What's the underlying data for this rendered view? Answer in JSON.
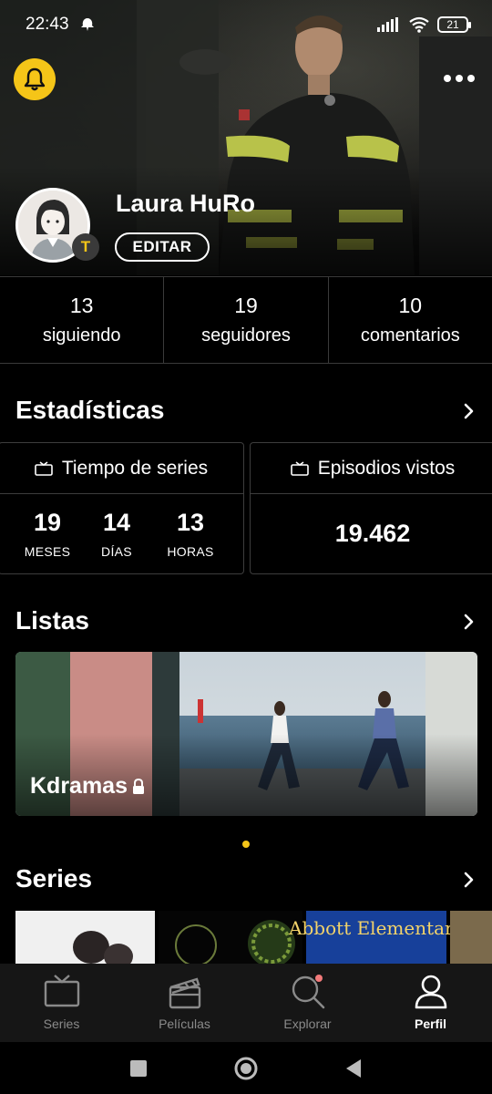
{
  "status_bar": {
    "time": "22:43",
    "battery": "21"
  },
  "profile": {
    "name": "Laura HuRo",
    "edit_label": "EDITAR",
    "badge_letter": "T"
  },
  "follow_stats": [
    {
      "value": "13",
      "label": "siguiendo"
    },
    {
      "value": "19",
      "label": "seguidores"
    },
    {
      "value": "10",
      "label": "comentarios"
    }
  ],
  "stats": {
    "title": "Estadísticas",
    "series_time": {
      "title": "Tiempo de series",
      "units": [
        {
          "value": "19",
          "label": "MESES"
        },
        {
          "value": "14",
          "label": "DÍAS"
        },
        {
          "value": "13",
          "label": "HORAS"
        }
      ]
    },
    "episodes": {
      "title": "Episodios vistos",
      "value": "19.462"
    }
  },
  "lists": {
    "title": "Listas",
    "items": [
      {
        "name": "Kdramas",
        "locked": true
      }
    ]
  },
  "series": {
    "title": "Series",
    "poster_text": "Abbott Elementary"
  },
  "nav": [
    {
      "label": "Series",
      "icon": "tv-icon",
      "active": false
    },
    {
      "label": "Películas",
      "icon": "clapperboard-icon",
      "active": false
    },
    {
      "label": "Explorar",
      "icon": "search-icon",
      "active": false
    },
    {
      "label": "Perfil",
      "icon": "person-icon",
      "active": true
    }
  ],
  "colors": {
    "accent": "#f5c518",
    "background": "#000000",
    "border": "#3a3a3a"
  }
}
